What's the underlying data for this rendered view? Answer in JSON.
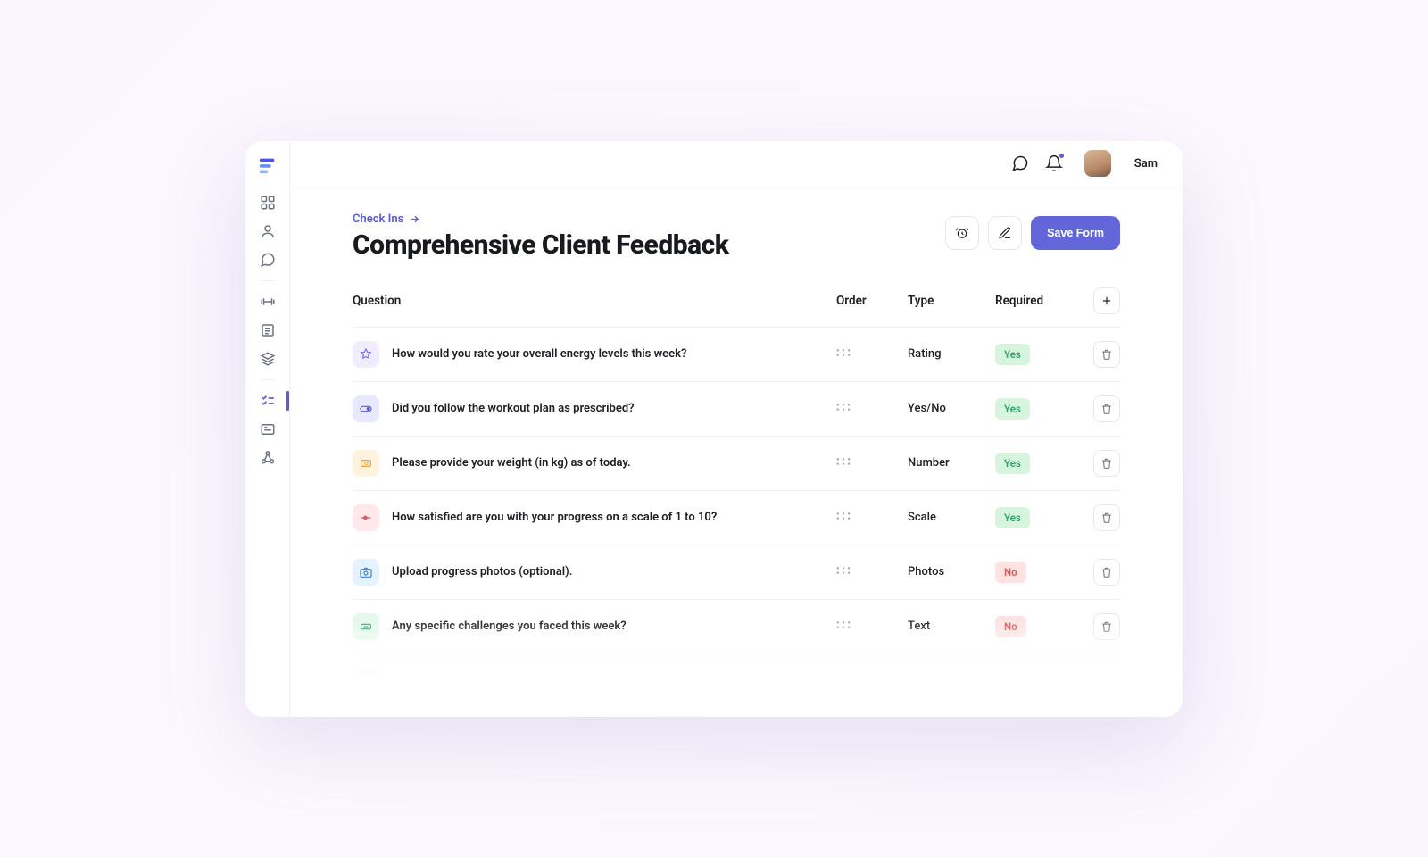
{
  "user": {
    "name": "Sam"
  },
  "breadcrumb": {
    "label": "Check Ins"
  },
  "page": {
    "title": "Comprehensive Client Feedback"
  },
  "actions": {
    "save": "Save Form"
  },
  "table": {
    "headers": {
      "question": "Question",
      "order": "Order",
      "type": "Type",
      "required": "Required"
    },
    "required_labels": {
      "yes": "Yes",
      "no": "No"
    },
    "rows": [
      {
        "text": "How would you rate your overall energy levels this week?",
        "type": "Rating",
        "required": true,
        "icon": "star",
        "palette": "purple"
      },
      {
        "text": "Did you follow the workout plan as prescribed?",
        "type": "Yes/No",
        "required": true,
        "icon": "toggle",
        "palette": "indigo"
      },
      {
        "text": "Please provide your weight (in kg) as of today.",
        "type": "Number",
        "required": true,
        "icon": "number",
        "palette": "amber"
      },
      {
        "text": "How satisfied are you with your progress on a scale of 1 to 10?",
        "type": "Scale",
        "required": true,
        "icon": "slider",
        "palette": "rose"
      },
      {
        "text": "Upload progress photos (optional).",
        "type": "Photos",
        "required": false,
        "icon": "camera",
        "palette": "sky"
      },
      {
        "text": "Any specific challenges you faced this week?",
        "type": "Text",
        "required": false,
        "icon": "textab",
        "palette": "green"
      }
    ]
  }
}
